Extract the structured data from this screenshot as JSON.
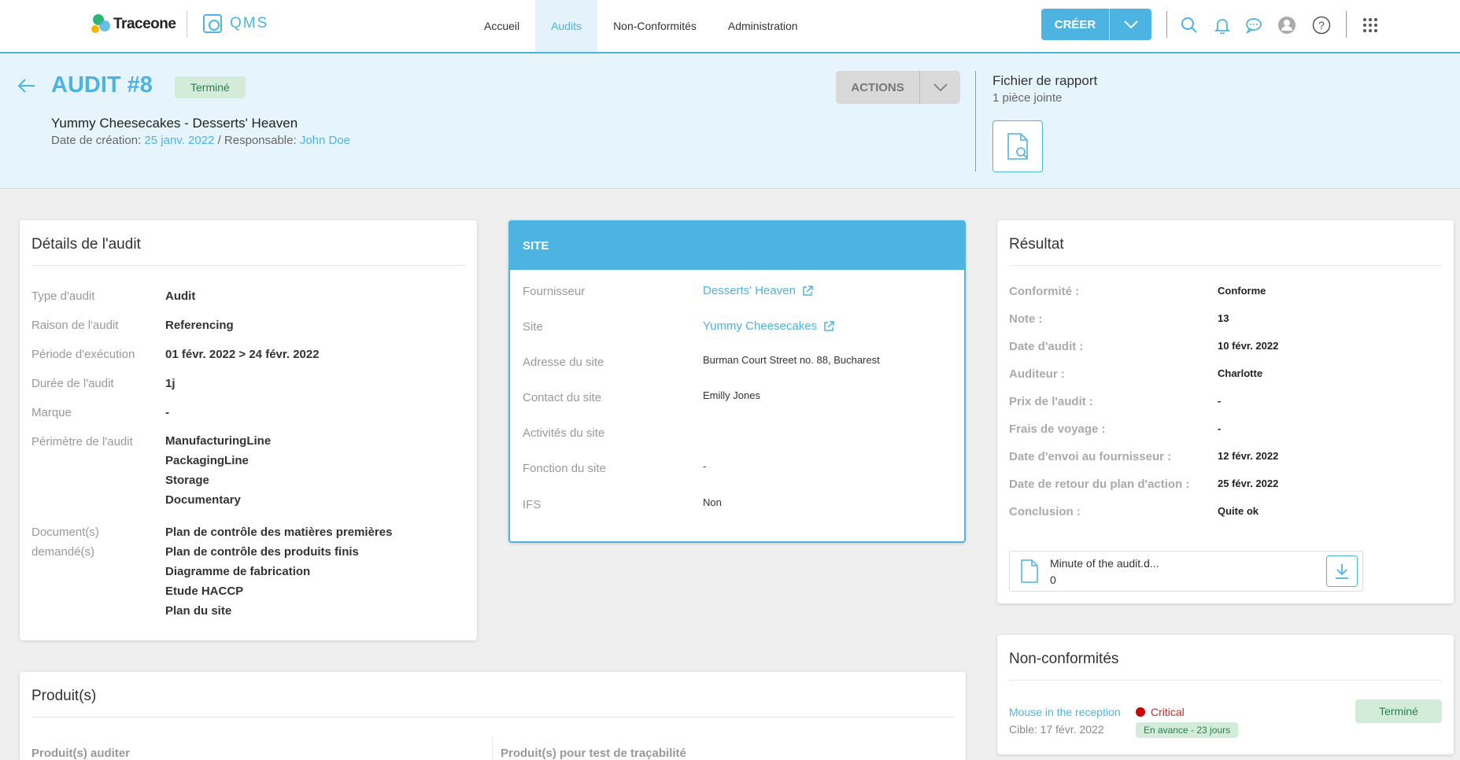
{
  "brand": {
    "logo_text": "Traceone",
    "app_name": "QMS"
  },
  "nav": {
    "items": [
      "Accueil",
      "Audits",
      "Non-Conformités",
      "Administration"
    ],
    "active": "Audits"
  },
  "create_label": "CRÉER",
  "colors": {
    "accent": "#4db3e0",
    "success_bg": "#d3ecd9",
    "success_text": "#2e7d4f",
    "critical": "#c62828"
  },
  "header": {
    "title": "AUDIT #8",
    "status": "Terminé",
    "subtitle": "Yummy Cheesecakes - Desserts' Heaven",
    "created_label": "Date de création:",
    "created_date": "25 janv. 2022",
    "owner_label": "/ Responsable:",
    "owner": "John Doe",
    "actions_label": "ACTIONS",
    "report_title": "Fichier de rapport",
    "report_count": "1 pièce jointe"
  },
  "details": {
    "title": "Détails de l'audit",
    "rows": [
      {
        "label": "Type d'audit",
        "value": "Audit"
      },
      {
        "label": "Raison de l'audit",
        "value": "Referencing"
      },
      {
        "label": "Période d'exécution",
        "value": "01 févr. 2022 > 24 févr. 2022"
      },
      {
        "label": "Durée de l'audit",
        "value": "1j"
      },
      {
        "label": "Marque",
        "value": "-"
      }
    ],
    "scope_label": "Périmètre de l'audit",
    "scope": [
      "ManufacturingLine",
      "PackagingLine",
      "Storage",
      "Documentary"
    ],
    "docs_label_1": "Document(s)",
    "docs_label_2": "demandé(s)",
    "docs": [
      "Plan de contrôle des matières premières",
      "Plan de contrôle des produits finis",
      "Diagramme de fabrication",
      "Etude HACCP",
      "Plan du site"
    ]
  },
  "site": {
    "title": "SITE",
    "supplier_label": "Fournisseur",
    "supplier": "Desserts' Heaven",
    "site_label": "Site",
    "site": "Yummy Cheesecakes",
    "address_label": "Adresse du site",
    "address": "Burman Court Street no. 88, Bucharest",
    "contact_label": "Contact du site",
    "contact": "Emilly Jones",
    "activities_label": "Activités du site",
    "activities": "",
    "function_label": "Fonction du site",
    "function": "-",
    "ifs_label": "IFS",
    "ifs": "Non"
  },
  "result": {
    "title": "Résultat",
    "rows": [
      {
        "label": "Conformité :",
        "value": "Conforme"
      },
      {
        "label": "Note :",
        "value": "13"
      },
      {
        "label": "Date d'audit :",
        "value": "10 févr. 2022"
      },
      {
        "label": "Auditeur :",
        "value": "Charlotte"
      },
      {
        "label": "Prix de l'audit :",
        "value": "-"
      },
      {
        "label": "Frais de voyage :",
        "value": "-"
      },
      {
        "label": "Date d'envoi au fournisseur :",
        "value": "12 févr. 2022"
      },
      {
        "label": "Date de retour du plan d'action :",
        "value": "25 févr. 2022"
      },
      {
        "label": "Conclusion :",
        "value": "Quite ok"
      }
    ],
    "attachment_name": "Minute of the audit.d...",
    "attachment_count": "0"
  },
  "nonconf": {
    "title": "Non-conformités",
    "item_title": "Mouse in the reception",
    "item_target": "Cible: 17 févr. 2022",
    "severity": "Critical",
    "ahead": "En avance - 23 jours",
    "status": "Terminé"
  },
  "products": {
    "title": "Produit(s)",
    "col1": "Produit(s) auditer",
    "col2": "Produit(s) pour test de traçabilité"
  }
}
